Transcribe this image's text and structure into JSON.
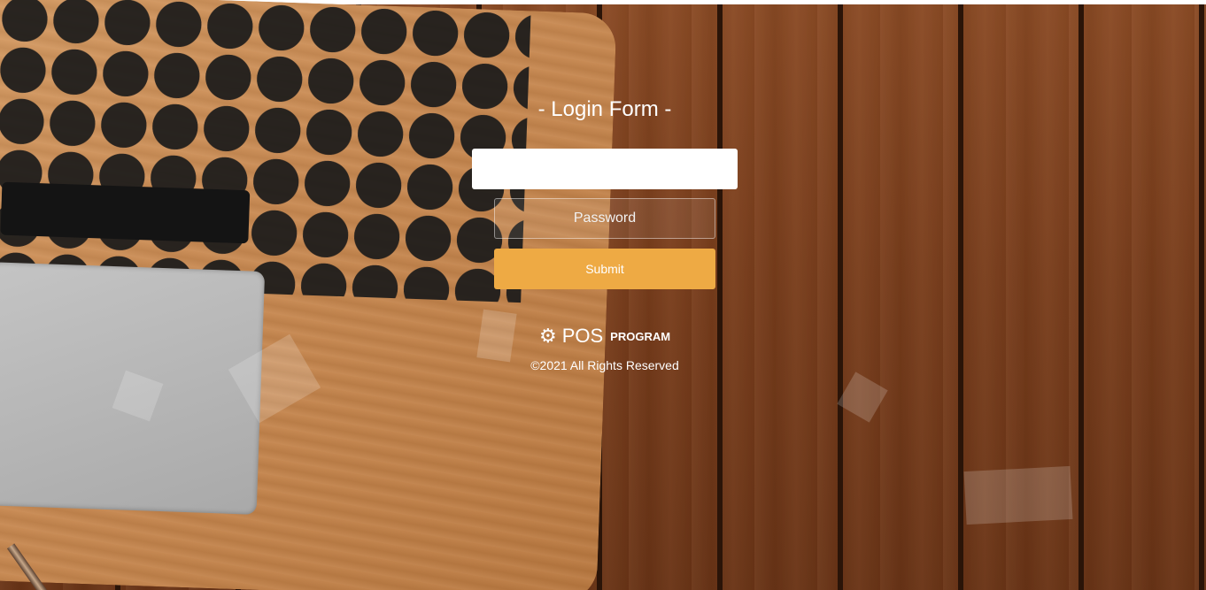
{
  "login": {
    "title": "- Login Form -",
    "username_value": "",
    "password_placeholder": "Password",
    "submit_label": "Submit"
  },
  "brand": {
    "icon": "gear-icon",
    "name": "POS",
    "suffix": "PROGRAM"
  },
  "footer": {
    "copyright": "©2021 All Rights Reserved"
  },
  "colors": {
    "submit": "#eeaa44",
    "text": "#ffffff"
  }
}
